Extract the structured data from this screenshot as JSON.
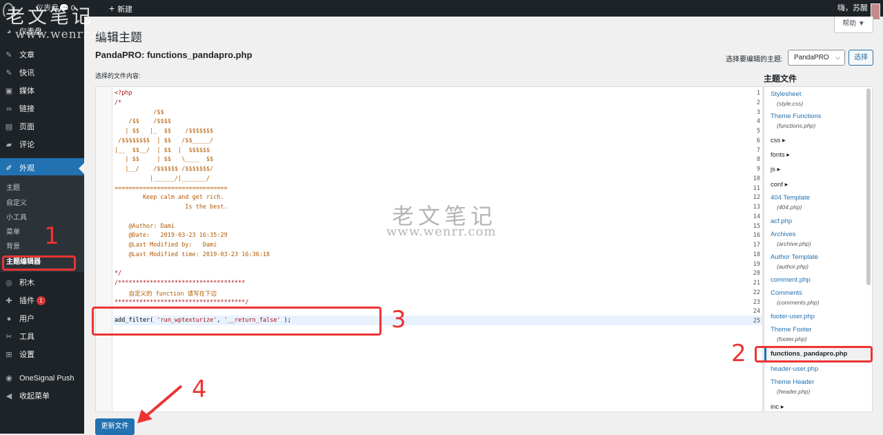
{
  "adminbar": {
    "site": "仪表盘",
    "comments": "0",
    "new_label": "新建",
    "howdy": "嗨，苏醒"
  },
  "watermark": {
    "top_text": "老文笔记",
    "top_url": "www.wenrr.co",
    "center_text": "老文笔记",
    "center_url": "www.wenrr.com"
  },
  "sidebar": {
    "items": [
      {
        "label": "仪表盘",
        "icon": "dashboard-icon"
      },
      {
        "label": "文章",
        "icon": "pin-icon"
      },
      {
        "label": "快讯",
        "icon": "pin-icon"
      },
      {
        "label": "媒体",
        "icon": "media-icon"
      },
      {
        "label": "链接",
        "icon": "link-icon"
      },
      {
        "label": "页面",
        "icon": "page-icon"
      },
      {
        "label": "评论",
        "icon": "comment-icon"
      },
      {
        "label": "外观",
        "icon": "brush-icon"
      }
    ],
    "submenu": [
      "主题",
      "自定义",
      "小工具",
      "菜单",
      "背景",
      "主题编辑器"
    ],
    "items_bottom": [
      {
        "label": "积木",
        "icon": "blocks-icon"
      },
      {
        "label": "插件",
        "icon": "plugin-icon",
        "badge": "1"
      },
      {
        "label": "用户",
        "icon": "user-icon"
      },
      {
        "label": "工具",
        "icon": "wrench-icon"
      },
      {
        "label": "设置",
        "icon": "settings-icon"
      },
      {
        "label": "OneSignal Push",
        "icon": "onesignal-icon"
      },
      {
        "label": "收起菜单",
        "icon": "collapse-icon"
      }
    ]
  },
  "header": {
    "title": "编辑主题",
    "help": "帮助 ▼",
    "file_title": "PandaPRO: functions_pandapro.php",
    "theme_label": "选择要编辑的主题:",
    "theme_value": "PandaPRO",
    "select_btn": "选择",
    "content_label": "选择的文件内容:"
  },
  "editor": {
    "line_numbers": [
      "1",
      "2",
      "3",
      "4",
      "5",
      "6",
      "7",
      "8",
      "9",
      "10",
      "11",
      "12",
      "13",
      "14",
      "15",
      "16",
      "17",
      "18",
      "19",
      "20",
      "21",
      "22",
      "23",
      "24",
      "25"
    ],
    "lines": [
      "<?php",
      "/*",
      "           /$$",
      "    /$$    /$$$$",
      "   | $$   |_  $$    /$$$$$$$",
      " /$$$$$$$$  | $$   /$$_____/",
      "|__  $$__/  | $$  |  $$$$$$",
      "   | $$     | $$   \\____  $$",
      "   |__/    /$$$$$$ /$$$$$$$/",
      "          |______/|_______/",
      "================================",
      "        Keep calm and get rich.",
      "                    Is the best.",
      "",
      "    @Author: Dami",
      "    @Date:   2019-03-23 16:35:29",
      "    @Last Modified by:   Dami",
      "    @Last Modified time: 2019-03-23 16:36:18",
      "",
      "*/",
      "/************************************",
      "    自定义的 function 请写在下边",
      "*************************************/",
      "",
      ""
    ],
    "filter_fn": "add_filter( ",
    "filter_arg1": "'run_wptexturize'",
    "filter_sep": ", ",
    "filter_arg2": "'__return_false'",
    "filter_end": " );"
  },
  "files": {
    "heading": "主题文件",
    "entries": [
      {
        "name": "Stylesheet",
        "sub": "(style.css)"
      },
      {
        "name": "Theme Functions",
        "sub": "(functions.php)"
      },
      {
        "name": "css",
        "dir": true
      },
      {
        "name": "fonts",
        "dir": true
      },
      {
        "name": "js",
        "dir": true
      },
      {
        "name": "conf",
        "dir": true
      },
      {
        "name": "404 Template",
        "sub": "(404.php)"
      },
      {
        "name": "acf.php"
      },
      {
        "name": "Archives",
        "sub": "(archive.php)"
      },
      {
        "name": "Author Template",
        "sub": "(author.php)"
      },
      {
        "name": "comment.php"
      },
      {
        "name": "Comments",
        "sub": "(comments.php)"
      },
      {
        "name": "footer-user.php"
      },
      {
        "name": "Theme Footer",
        "sub": "(footer.php)"
      },
      {
        "name": "functions_pandapro.php",
        "current": true
      },
      {
        "name": "header-user.php"
      },
      {
        "name": "Theme Header",
        "sub": "(header.php)"
      },
      {
        "name": "inc",
        "dir": true
      }
    ]
  },
  "update_btn": "更新文件",
  "annotations": [
    "1",
    "2",
    "3",
    "4"
  ],
  "colors": {
    "accent": "#2271b1",
    "annotation": "#ee3333",
    "sidebar": "#1d2327"
  }
}
